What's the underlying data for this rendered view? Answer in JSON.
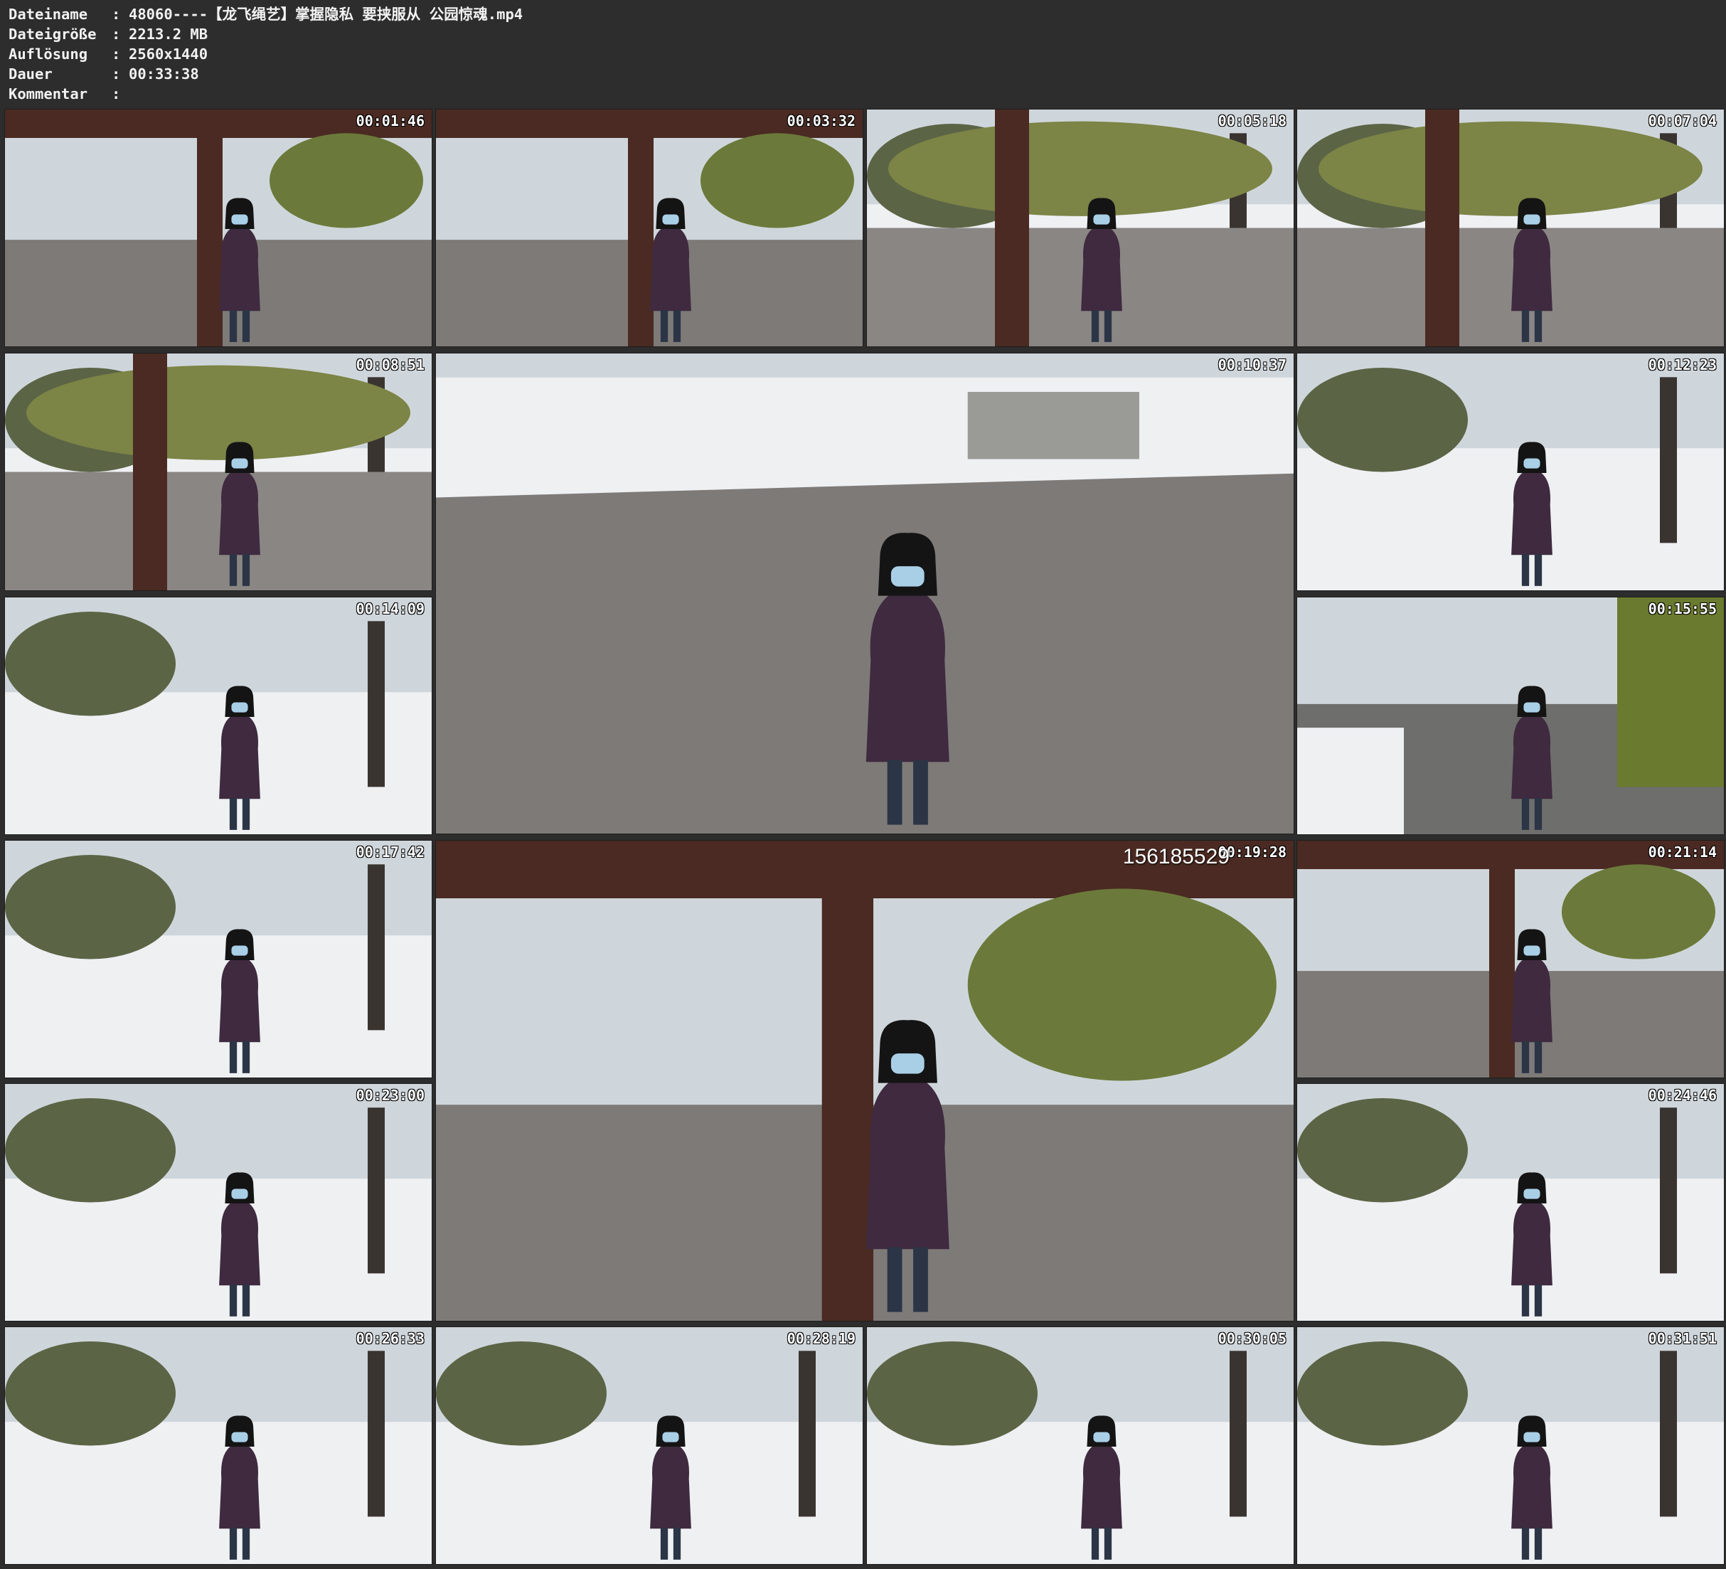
{
  "header": {
    "fields": [
      {
        "key": "Dateiname",
        "value": "48060----【龙飞绳艺】掌握隐私 要挟服从 公园惊魂.mp4"
      },
      {
        "key": "Dateigröße",
        "value": "2213.2 MB"
      },
      {
        "key": "Auflösung",
        "value": "2560x1440"
      },
      {
        "key": "Dauer",
        "value": "00:33:38"
      },
      {
        "key": "Kommentar",
        "value": ""
      }
    ],
    "separator": ":"
  },
  "thumbnails": [
    {
      "timestamp": "00:01:46",
      "scene": "pavilion"
    },
    {
      "timestamp": "00:03:32",
      "scene": "pavilion"
    },
    {
      "timestamp": "00:05:18",
      "scene": "park"
    },
    {
      "timestamp": "00:07:04",
      "scene": "park"
    },
    {
      "timestamp": "00:08:51",
      "scene": "park"
    },
    {
      "timestamp": "00:10:37",
      "scene": "path"
    },
    {
      "timestamp": "00:12:23",
      "scene": "snow"
    },
    {
      "timestamp": "00:14:09",
      "scene": "snow"
    },
    {
      "timestamp": "00:15:55",
      "scene": "road"
    },
    {
      "timestamp": "00:17:42",
      "scene": "snow"
    },
    {
      "timestamp": "00:19:28",
      "scene": "pavilion",
      "overlay": "156185529"
    },
    {
      "timestamp": "00:21:14",
      "scene": "pavilion"
    },
    {
      "timestamp": "00:23:00",
      "scene": "snow"
    },
    {
      "timestamp": "00:24:46",
      "scene": "snow"
    },
    {
      "timestamp": "00:26:33",
      "scene": "snow"
    },
    {
      "timestamp": "00:28:19",
      "scene": "snow"
    },
    {
      "timestamp": "00:30:05",
      "scene": "snow"
    },
    {
      "timestamp": "00:31:51",
      "scene": "snow"
    }
  ],
  "colors": {
    "background": "#2d2d2d",
    "header_text": "#f2f2f2",
    "snow": "#eef0f2",
    "coat": "#3f2a3f",
    "wood": "#4a2a22",
    "pavement": "#7d7a78"
  }
}
